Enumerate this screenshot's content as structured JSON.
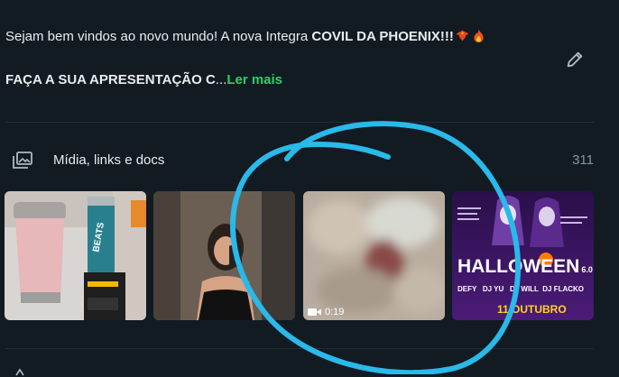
{
  "description": {
    "line1_prefix": "Sejam bem vindos ao novo mundo! A nova Integra ",
    "line1_bold": "COVIL DA PHOENIX!!!",
    "line2_bold": "FAÇA A SUA APRESENTAÇÃO C",
    "ellipsis": "...",
    "read_more": "Ler mais"
  },
  "media_section": {
    "label": "Mídia, links e docs",
    "count": "311"
  },
  "thumbnails": [
    {
      "type": "image",
      "subject": "pink tumbler and energy drink"
    },
    {
      "type": "image",
      "subject": "mirror selfie"
    },
    {
      "type": "video",
      "duration": "0:19"
    },
    {
      "type": "image",
      "subject": "halloween party flyer",
      "poster_title": "HALLOWEEN",
      "poster_edition": "6.0",
      "poster_djs": "DEFY   DJ YU   DJ WILL  DJ FLACKO",
      "poster_date": "11.OUTUBRO"
    }
  ],
  "colors": {
    "background": "#111b21",
    "accent_link": "#25d366",
    "annotation_circle": "#29b9ea",
    "muted_text": "#8696a0"
  },
  "icons": {
    "edit": "pencil-icon",
    "media": "photo-stack-icon",
    "video": "video-camera-icon",
    "emoji_1": "phoenix-emoji-icon",
    "emoji_2": "fire-emoji-icon"
  }
}
